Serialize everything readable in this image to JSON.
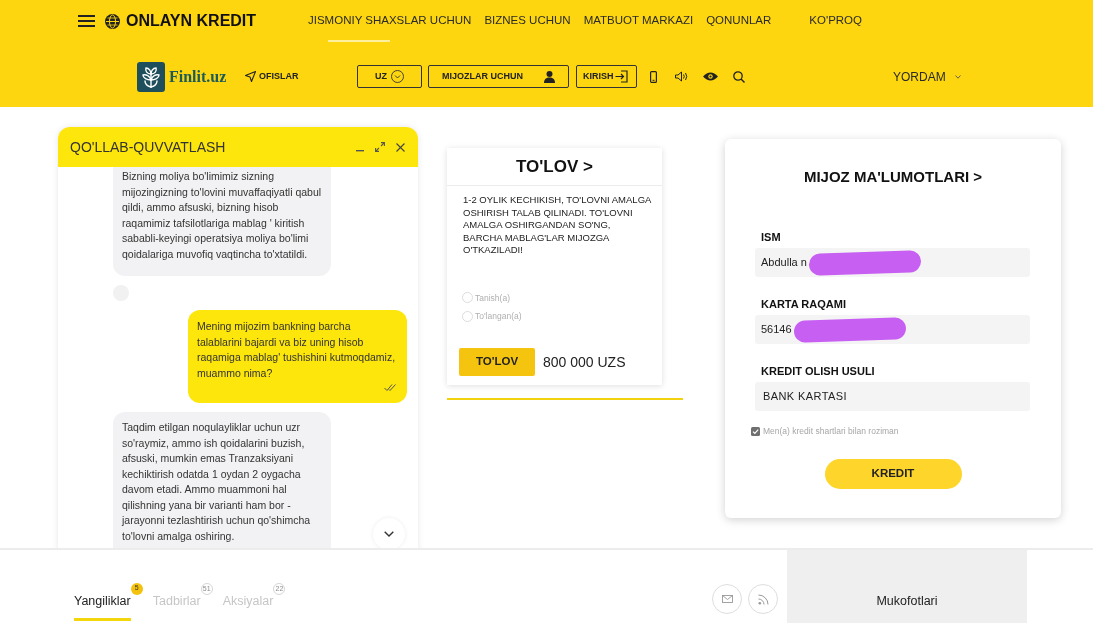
{
  "header": {
    "brand": "ONLAYN KREDIT",
    "nav": [
      {
        "label": "JISMONIY SHAXSLAR UCHUN",
        "selected": true
      },
      {
        "label": "BIZNES UCHUN",
        "selected": false
      },
      {
        "label": "MATBUOT MARKAZI",
        "selected": false
      },
      {
        "label": "QONUNLAR",
        "selected": false
      },
      {
        "label": "KO'PROQ",
        "selected": false
      }
    ],
    "logo_text": "Finlit.uz",
    "offices_link": "OFISLAR",
    "buttons": [
      {
        "kind": "language",
        "label": "UZ"
      },
      {
        "kind": "clients",
        "label": "MIJOZLAR UCHUN"
      },
      {
        "kind": "login",
        "label": "KIRISH"
      }
    ],
    "help_menu": "YORDAM"
  },
  "chat": {
    "title": "QO'LLAB-QUVVATLASH",
    "messages": [
      {
        "kind": "incoming",
        "text": "Bizning moliya bo'limimiz sizning mijozingizning to'lovini muvaffaqiyatli qabul qildi, ammo afsuski, bizning hisob raqamimiz tafsilotlariga mablag ' kiritish sababli-keyingi operatsiya moliya bo'limi qoidalariga muvofiq vaqtincha to'xtatildi."
      },
      {
        "kind": "avatar"
      },
      {
        "kind": "outgoing",
        "read": true,
        "text": "Mening mijozim bankning barcha talablarini bajardi va biz uning hisob raqamiga mablag' tushishini kutmoqdamiz, muammo nima?"
      },
      {
        "kind": "incoming",
        "text": "Taqdim etilgan noqulayliklar uchun uzr so'raymiz, ammo ish qoidalarini buzish, afsuski, mumkin emas Tranzaksiyani kechiktirish odatda 1 oydan 2 oygacha davom etadi. Ammo muammoni hal qilishning yana bir varianti ham bor - jarayonni tezlashtirish uchun qo'shimcha to'lovni amalga oshiring."
      }
    ]
  },
  "payment": {
    "title": "TO'LOV >",
    "notice": "1-2 OYLIK KECHIKISH, TO'LOVNI AMALGA OSHIRISH TALAB QILINADI. TO'LOVNI AMALGA OSHIRGANDAN SO'NG, BARCHA MABLAG'LAR MIJOZGA O'TKAZILADI!",
    "options": [
      {
        "label": "Tanish(a)",
        "selected": false
      },
      {
        "label": "To'langan(a)",
        "selected": false
      }
    ],
    "button": "TO'LOV",
    "amount": "800 000 UZS"
  },
  "client_form": {
    "title": "MIJOZ MA'LUMOTLARI >",
    "fields": [
      {
        "label": "ISM",
        "value": "Abdulla n",
        "redacted": true
      },
      {
        "label": "KARTA RAQAMI",
        "value": "56146",
        "redacted": true
      },
      {
        "label": "KREDIT OLISH USULI",
        "value": "BANK KARTASI",
        "redacted": false
      }
    ],
    "agreement": {
      "label": "Men(a) kredit shartlari bilan roziman",
      "checked": true
    },
    "button": "KREDIT"
  },
  "footer": {
    "tabs": [
      {
        "label": "Yangiliklar",
        "badge": "5",
        "selected": true
      },
      {
        "label": "Tadbirlar",
        "badge": "51",
        "selected": false
      },
      {
        "label": "Aksiyalar",
        "badge": "22",
        "selected": false
      }
    ],
    "awards_panel": "Mukofotlari"
  }
}
